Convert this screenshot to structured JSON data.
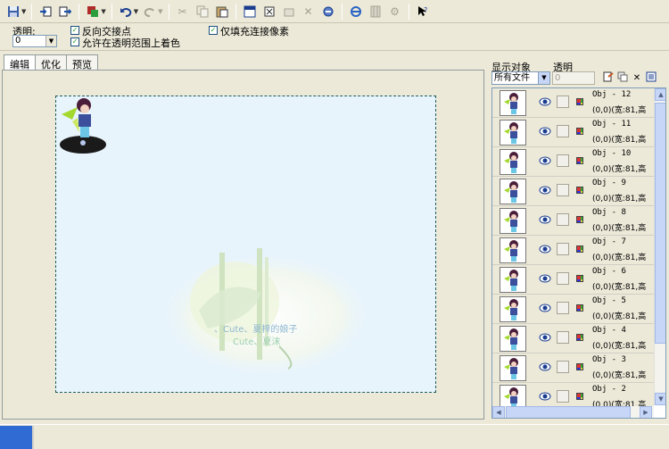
{
  "toolbar": {
    "buttons": [
      "save-icon",
      "dropdown",
      "import-icon",
      "export-icon",
      "color-icon",
      "dropdown",
      "undo-icon",
      "dropdown",
      "redo-icon",
      "dropdown",
      "cut-icon",
      "copy-icon",
      "paste-icon",
      "frame-icon",
      "crop-icon",
      "layer-icon",
      "delete-icon",
      "rotate-icon",
      "ie-icon",
      "film-icon",
      "gear-icon",
      "help-pointer-icon"
    ]
  },
  "options": {
    "alpha_label": "透明:",
    "alpha_value": "0",
    "reverse_label": "反向交接点",
    "allow_label": "允许在透明范围上着色",
    "fill_label": "仅填充连接像素",
    "reverse_checked": true,
    "allow_checked": true,
    "fill_checked": true
  },
  "tabs": [
    "编辑",
    "优化",
    "预览"
  ],
  "canvas": {
    "caption1": "、Cute、夏梓的娘子",
    "caption2": "Cute、夏沫",
    "bg_color": "#e8f4fc"
  },
  "panel": {
    "show_label": "显示对象",
    "alpha_label": "透明",
    "filter_value": "所有文件",
    "alpha_value": "0",
    "objects": [
      {
        "name": "Obj - 12",
        "info": "(0,0)(宽:81,高"
      },
      {
        "name": "Obj - 11",
        "info": "(0,0)(宽:81,高"
      },
      {
        "name": "Obj - 10",
        "info": "(0,0)(宽:81,高"
      },
      {
        "name": "Obj - 9",
        "info": "(0,0)(宽:81,高"
      },
      {
        "name": "Obj - 8",
        "info": "(0,0)(宽:81,高"
      },
      {
        "name": "Obj - 7",
        "info": "(0,0)(宽:81,高"
      },
      {
        "name": "Obj - 6",
        "info": "(0,0)(宽:81,高"
      },
      {
        "name": "Obj - 5",
        "info": "(0,0)(宽:81,高"
      },
      {
        "name": "Obj - 4",
        "info": "(0,0)(宽:81,高"
      },
      {
        "name": "Obj - 3",
        "info": "(0,0)(宽:81,高"
      },
      {
        "name": "Obj - 2",
        "info": "(0,0)(宽:81,高"
      }
    ]
  }
}
